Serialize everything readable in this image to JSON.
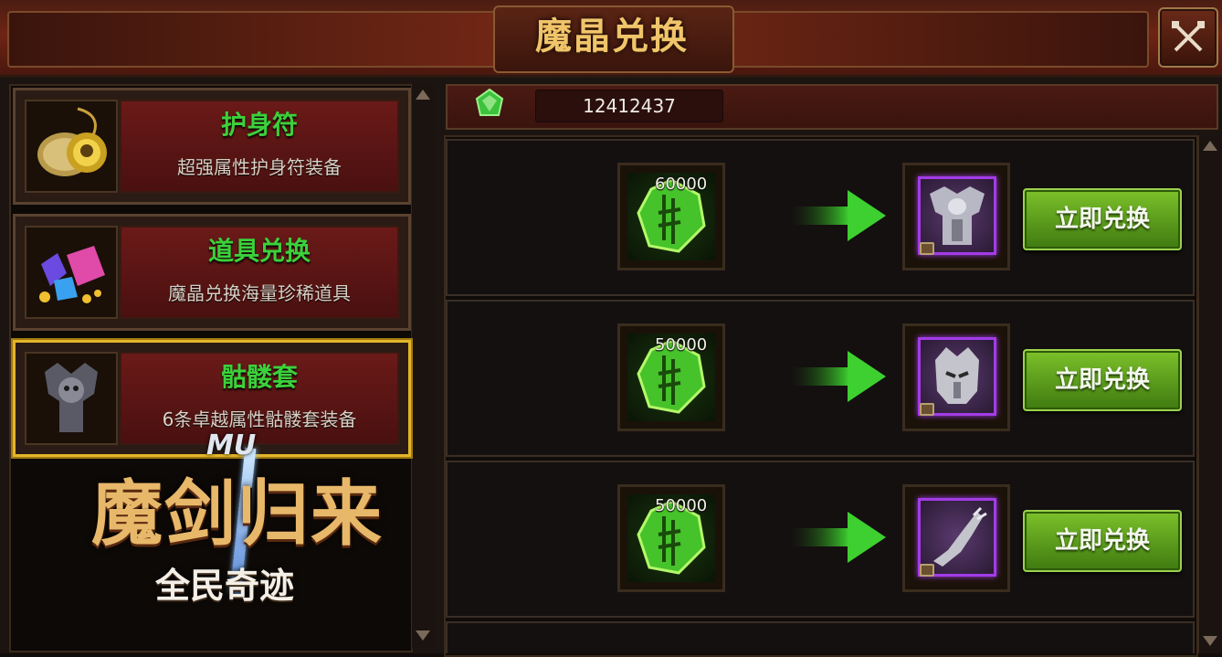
{
  "window": {
    "title": "魔晶兑换",
    "close_icon": "close-x-icon"
  },
  "balance": {
    "icon": "green-crystal-icon",
    "amount": "12412437"
  },
  "categories": [
    {
      "title": "护身符",
      "desc": "超强属性护身符装备",
      "icon": "amulet-icon",
      "selected": false
    },
    {
      "title": "道具兑换",
      "desc": "魔晶兑换海量珍稀道具",
      "icon": "gems-icon",
      "selected": false
    },
    {
      "title": "骷髅套",
      "desc": "6条卓越属性骷髅套装备",
      "icon": "skeleton-armor-icon",
      "selected": true
    }
  ],
  "exchanges": [
    {
      "cost": "60000",
      "reward_icon": "chest-armor-icon",
      "button": "立即兑换"
    },
    {
      "cost": "50000",
      "reward_icon": "helmet-icon",
      "button": "立即兑换"
    },
    {
      "cost": "50000",
      "reward_icon": "gauntlet-icon",
      "button": "立即兑换"
    }
  ],
  "logo": {
    "brand": "MU",
    "main": "魔剑归来",
    "sub": "全民奇迹"
  },
  "colors": {
    "accent_green": "#3bd13b",
    "title_gold": "#f0c56a",
    "selected_border": "#e3b52a",
    "rarity_purple": "#a23ce6"
  }
}
